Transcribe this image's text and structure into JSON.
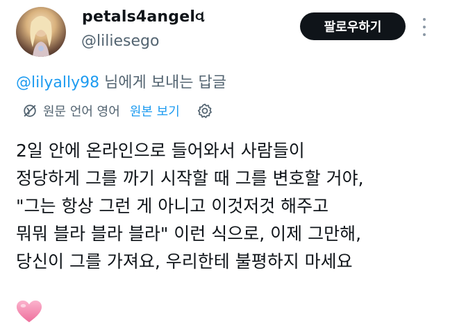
{
  "author": {
    "display_name": "petals4angelવ",
    "handle": "@liliesego"
  },
  "follow_button": {
    "label": "팔로우하기"
  },
  "reply_context": {
    "mention": "@lilyally98",
    "suffix": " 님에게 보내는 답글"
  },
  "translation": {
    "source_language_label": "원문 언어 영어",
    "show_original_label": "원본 보기"
  },
  "post": {
    "lines": [
      "2일 안에 온라인으로 들어와서 사람들이",
      "정당하게 그를 까기 시작할 때 그를 변호할 거야,",
      "\"그는 항상 그런 게 아니고 이것저것 해주고",
      "뭐뭐 블라 블라 블라\" 이런 식으로, 이제 그만해,",
      "당신이 그를 가져요, 우리한테 불평하지 마세요"
    ],
    "emoji": "pink-heart"
  },
  "colors": {
    "text": "#0f1419",
    "secondary": "#536471",
    "link": "#1d9bf0",
    "button": "#0f1419",
    "heart": "#f58fb5"
  }
}
